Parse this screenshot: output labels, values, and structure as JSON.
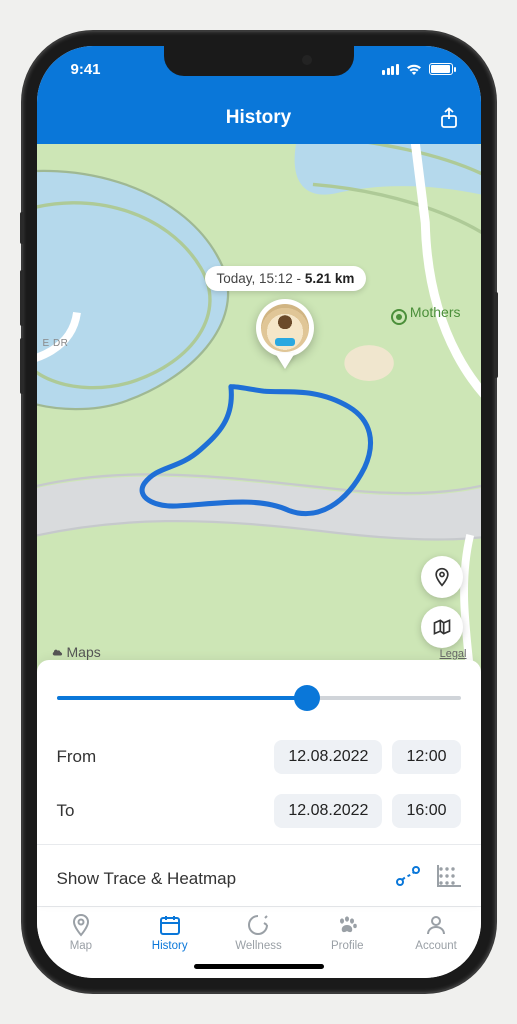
{
  "statusbar": {
    "time": "9:41"
  },
  "header": {
    "title": "History"
  },
  "map": {
    "tooltip_prefix": "Today, 15:12 - ",
    "tooltip_distance": "5.21 km",
    "poi": "Mothers",
    "road": "E DR",
    "attrib": "Maps",
    "legal": "Legal"
  },
  "panel": {
    "slider_percent": 62,
    "from": {
      "label": "From",
      "date": "12.08.2022",
      "time": "12:00"
    },
    "to": {
      "label": "To",
      "date": "12.08.2022",
      "time": "16:00"
    },
    "trace_label": "Show Trace & Heatmap"
  },
  "tabs": {
    "map": "Map",
    "history": "History",
    "wellness": "Wellness",
    "profile": "Profile",
    "account": "Account"
  }
}
